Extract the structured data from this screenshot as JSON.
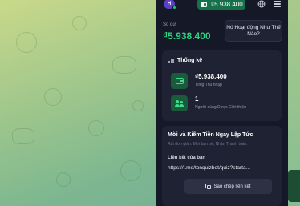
{
  "top_bar": {
    "avatar_initial": "H",
    "balance": "₫5.938.400"
  },
  "balance": {
    "label": "Số dư",
    "value": "₫5.938.400"
  },
  "inactive_button": {
    "label": "Nó Hoạt động Như Thế Nào?"
  },
  "stats": {
    "title": "Thống kê",
    "items": [
      {
        "value": "₫5.938.400",
        "label": "Tổng Thu nhập"
      },
      {
        "value": "1",
        "label": "Người dùng Được Giới thiệu"
      }
    ]
  },
  "invite": {
    "title": "Mời và Kiếm Tiền Ngay Lập Tức",
    "subtitle": "Rất đơn giản: Mời bạn bè, Nhận Thanh toán.",
    "link_label": "Liên kết của bạn",
    "link_url": "https://t.me/tonquizbot/quiz?starta...",
    "copy_button": "Sao chép liên kết"
  },
  "colors": {
    "app_bg": "#151826",
    "card_bg": "#1e2233",
    "accent_green": "#2fd07f",
    "balance_pill": "#16704a"
  }
}
